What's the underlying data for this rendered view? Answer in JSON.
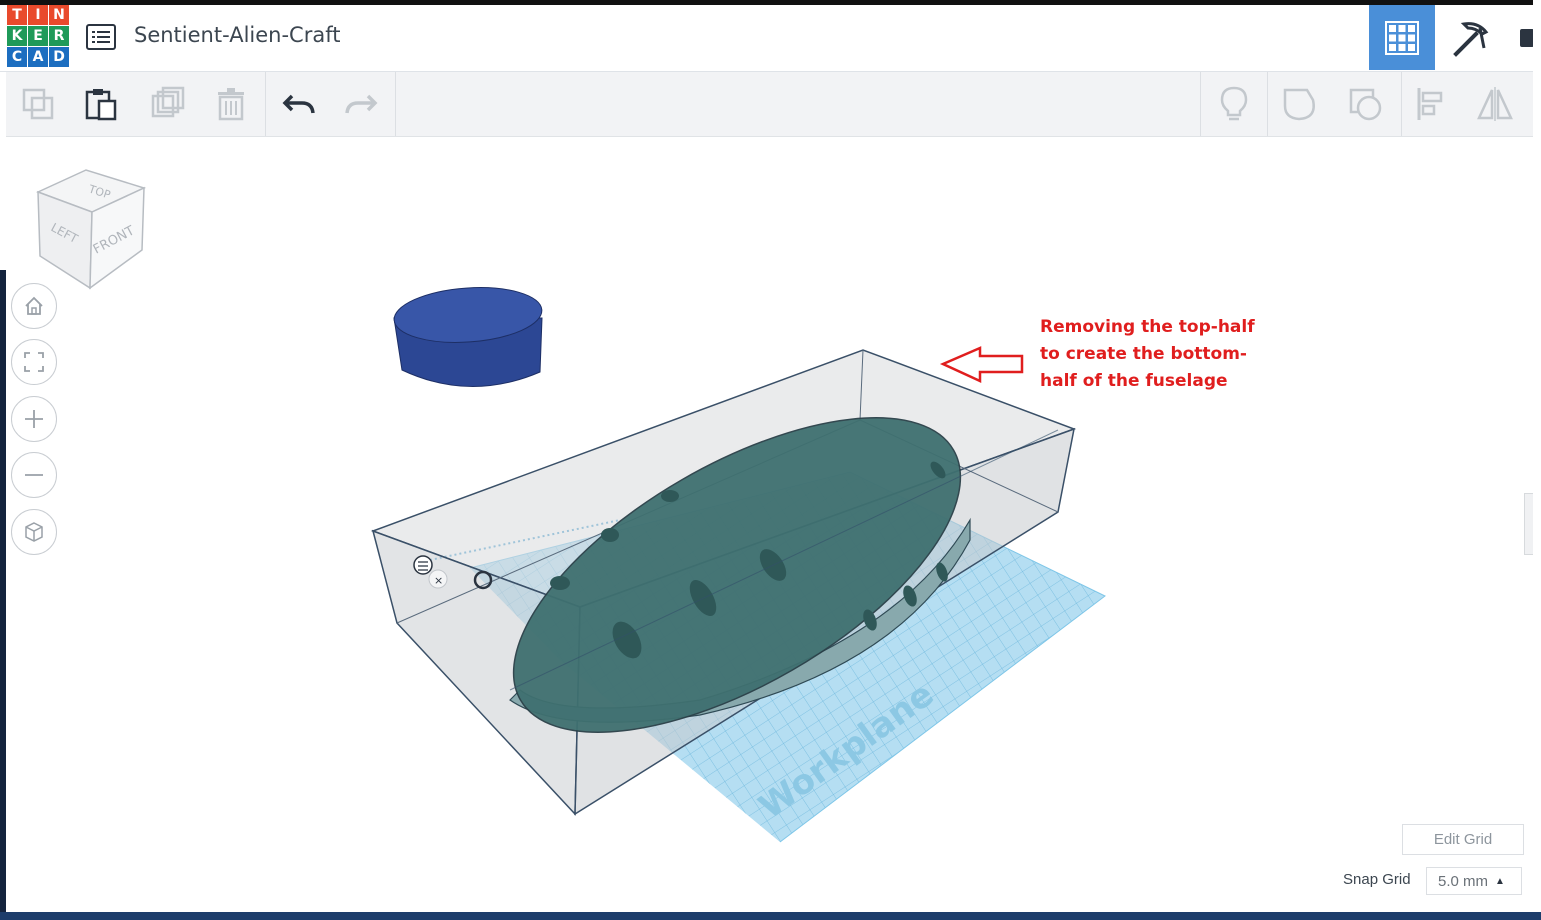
{
  "app": {
    "logo_letters": [
      "T",
      "I",
      "N",
      "K",
      "E",
      "R",
      "C",
      "A",
      "D"
    ],
    "logo_colors": [
      "#e94a2c",
      "#e94a2c",
      "#e94a2c",
      "#1f9a59",
      "#1f9a59",
      "#1f9a59",
      "#1c6ec0",
      "#1c6ec0",
      "#1c6ec0"
    ],
    "accent": "#4a8fd8"
  },
  "header": {
    "project_title": "Sentient-Alien-Craft",
    "menu_icon": "list-icon",
    "view_button_icon": "grid-view-icon",
    "build_button_icon": "pickaxe-icon"
  },
  "toolbar": {
    "left_tools": [
      "copy-icon",
      "paste-icon",
      "duplicate-icon",
      "delete-icon"
    ],
    "history_tools": [
      "undo-icon",
      "redo-icon"
    ],
    "right_tools": [
      "lightbulb-icon",
      "solid-shape-icon",
      "hole-shape-icon",
      "align-icon",
      "mirror-icon"
    ]
  },
  "viewcube": {
    "top_label": "TOP",
    "left_label": "LEFT",
    "front_label": "FRONT"
  },
  "nav_buttons": [
    "home-icon",
    "fit-view-icon",
    "zoom-in-icon",
    "zoom-out-icon",
    "perspective-icon"
  ],
  "scene": {
    "workplane_label": "Workplane",
    "box_color": "#b9bcc0",
    "ellipsoid_color": "#3e6f6e",
    "cylinder_color": "#2e4a9a"
  },
  "annotation": {
    "lines": [
      "Removing the top-half",
      "to create the bottom-",
      "half of the fuselage"
    ],
    "color": "#e01e1e"
  },
  "grid_controls": {
    "edit_grid_label": "Edit Grid",
    "snap_grid_label": "Snap Grid",
    "snap_grid_value": "5.0 mm"
  }
}
